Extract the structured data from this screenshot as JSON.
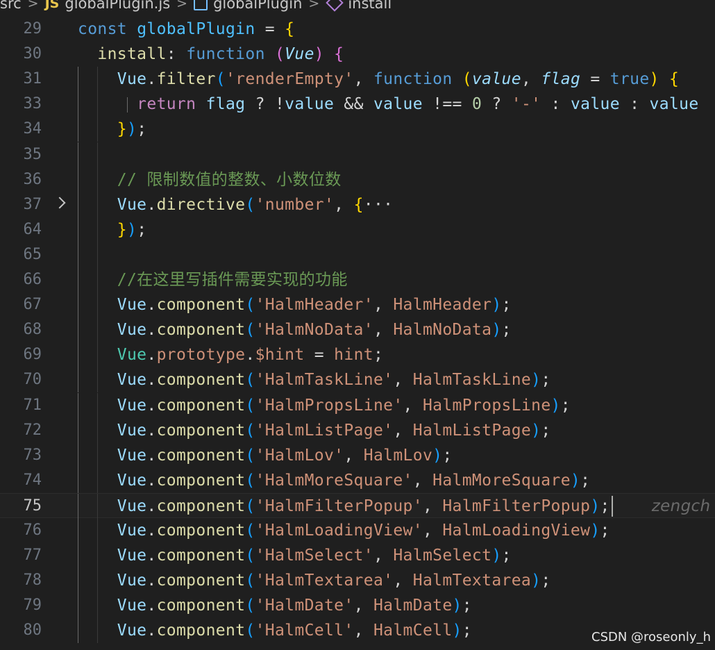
{
  "breadcrumb": {
    "folder": "src",
    "file_icon": "JS",
    "file": "globalPlugin.js",
    "symbol": "globalPlugin",
    "method": "install"
  },
  "editor": {
    "current_line": "75",
    "lines": [
      {
        "n": "29",
        "tokens": [
          [
            "c-kw",
            "const "
          ],
          [
            "c-def",
            "globalPlugin"
          ],
          [
            "c-pun",
            " = "
          ],
          [
            "c-br1",
            "{"
          ]
        ]
      },
      {
        "n": "30",
        "tokens": [
          [
            "c-fn",
            "  install"
          ],
          [
            "c-pun",
            ": "
          ],
          [
            "c-kw",
            "function "
          ],
          [
            "c-br2",
            "("
          ],
          [
            "c-prm",
            "Vue"
          ],
          [
            "c-br2",
            ")"
          ],
          [
            "c-pun",
            " "
          ],
          [
            "c-br2",
            "{"
          ]
        ]
      },
      {
        "n": "31",
        "tokens": [
          [
            "c-var",
            "    Vue"
          ],
          [
            "c-pun",
            "."
          ],
          [
            "c-fn",
            "filter"
          ],
          [
            "c-br3",
            "("
          ],
          [
            "c-str",
            "'renderEmpty'"
          ],
          [
            "c-pun",
            ", "
          ],
          [
            "c-kw",
            "function "
          ],
          [
            "c-br1",
            "("
          ],
          [
            "c-prm",
            "value"
          ],
          [
            "c-pun",
            ", "
          ],
          [
            "c-prm",
            "flag"
          ],
          [
            "c-pun",
            " = "
          ],
          [
            "c-kw",
            "true"
          ],
          [
            "c-br1",
            ")"
          ],
          [
            "c-pun",
            " "
          ],
          [
            "c-br1",
            "{"
          ]
        ]
      },
      {
        "n": "33",
        "tokens": [
          [
            "c-ctl",
            "      return "
          ],
          [
            "c-var",
            "flag"
          ],
          [
            "c-pun",
            " ? "
          ],
          [
            "c-pun",
            "!"
          ],
          [
            "c-var",
            "value"
          ],
          [
            "c-pun",
            " && "
          ],
          [
            "c-var",
            "value"
          ],
          [
            "c-pun",
            " !== "
          ],
          [
            "c-num",
            "0"
          ],
          [
            "c-pun",
            " ? "
          ],
          [
            "c-str",
            "'-'"
          ],
          [
            "c-pun",
            " : "
          ],
          [
            "c-var",
            "value"
          ],
          [
            "c-pun",
            " : "
          ],
          [
            "c-var",
            "value"
          ]
        ]
      },
      {
        "n": "34",
        "tokens": [
          [
            "c-br1",
            "    }"
          ],
          [
            "c-br3",
            ")"
          ],
          [
            "c-pun",
            ";"
          ]
        ]
      },
      {
        "n": "35",
        "tokens": []
      },
      {
        "n": "36",
        "tokens": [
          [
            "c-cm",
            "    // 限制数值的整数、小数位数"
          ]
        ]
      },
      {
        "n": "37",
        "fold": true,
        "tokens": [
          [
            "c-var",
            "    Vue"
          ],
          [
            "c-pun",
            "."
          ],
          [
            "c-fn",
            "directive"
          ],
          [
            "c-br3",
            "("
          ],
          [
            "c-str",
            "'number'"
          ],
          [
            "c-pun",
            ", "
          ],
          [
            "c-br1",
            "{"
          ],
          [
            "c-pun",
            "···"
          ]
        ]
      },
      {
        "n": "64",
        "tokens": [
          [
            "c-br1",
            "    }"
          ],
          [
            "c-br3",
            ")"
          ],
          [
            "c-pun",
            ";"
          ]
        ]
      },
      {
        "n": "65",
        "tokens": []
      },
      {
        "n": "66",
        "tokens": [
          [
            "c-cm",
            "    //在这里写插件需要实现的功能"
          ]
        ]
      },
      {
        "n": "67",
        "tokens": [
          [
            "c-var",
            "    Vue"
          ],
          [
            "c-pun",
            "."
          ],
          [
            "c-fn",
            "component"
          ],
          [
            "c-br3",
            "("
          ],
          [
            "c-str",
            "'HalmHeader'"
          ],
          [
            "c-pun",
            ", "
          ],
          [
            "c-str",
            "HalmHeader"
          ],
          [
            "c-br3",
            ")"
          ],
          [
            "c-pun",
            ";"
          ]
        ]
      },
      {
        "n": "68",
        "tokens": [
          [
            "c-var",
            "    Vue"
          ],
          [
            "c-pun",
            "."
          ],
          [
            "c-fn",
            "component"
          ],
          [
            "c-br3",
            "("
          ],
          [
            "c-str",
            "'HalmNoData'"
          ],
          [
            "c-pun",
            ", "
          ],
          [
            "c-str",
            "HalmNoData"
          ],
          [
            "c-br3",
            ")"
          ],
          [
            "c-pun",
            ";"
          ]
        ]
      },
      {
        "n": "69",
        "tokens": [
          [
            "c-cls",
            "    Vue"
          ],
          [
            "c-pun",
            "."
          ],
          [
            "c-str",
            "prototype"
          ],
          [
            "c-pun",
            "."
          ],
          [
            "c-str",
            "$hint"
          ],
          [
            "c-pun",
            " = "
          ],
          [
            "c-str",
            "hint"
          ],
          [
            "c-pun",
            ";"
          ]
        ]
      },
      {
        "n": "70",
        "tokens": [
          [
            "c-var",
            "    Vue"
          ],
          [
            "c-pun",
            "."
          ],
          [
            "c-fn",
            "component"
          ],
          [
            "c-br3",
            "("
          ],
          [
            "c-str",
            "'HalmTaskLine'"
          ],
          [
            "c-pun",
            ", "
          ],
          [
            "c-str",
            "HalmTaskLine"
          ],
          [
            "c-br3",
            ")"
          ],
          [
            "c-pun",
            ";"
          ]
        ]
      },
      {
        "n": "71",
        "tokens": [
          [
            "c-var",
            "    Vue"
          ],
          [
            "c-pun",
            "."
          ],
          [
            "c-fn",
            "component"
          ],
          [
            "c-br3",
            "("
          ],
          [
            "c-str",
            "'HalmPropsLine'"
          ],
          [
            "c-pun",
            ", "
          ],
          [
            "c-str",
            "HalmPropsLine"
          ],
          [
            "c-br3",
            ")"
          ],
          [
            "c-pun",
            ";"
          ]
        ]
      },
      {
        "n": "72",
        "tokens": [
          [
            "c-var",
            "    Vue"
          ],
          [
            "c-pun",
            "."
          ],
          [
            "c-fn",
            "component"
          ],
          [
            "c-br3",
            "("
          ],
          [
            "c-str",
            "'HalmListPage'"
          ],
          [
            "c-pun",
            ", "
          ],
          [
            "c-str",
            "HalmListPage"
          ],
          [
            "c-br3",
            ")"
          ],
          [
            "c-pun",
            ";"
          ]
        ]
      },
      {
        "n": "73",
        "tokens": [
          [
            "c-var",
            "    Vue"
          ],
          [
            "c-pun",
            "."
          ],
          [
            "c-fn",
            "component"
          ],
          [
            "c-br3",
            "("
          ],
          [
            "c-str",
            "'HalmLov'"
          ],
          [
            "c-pun",
            ", "
          ],
          [
            "c-str",
            "HalmLov"
          ],
          [
            "c-br3",
            ")"
          ],
          [
            "c-pun",
            ";"
          ]
        ]
      },
      {
        "n": "74",
        "tokens": [
          [
            "c-var",
            "    Vue"
          ],
          [
            "c-pun",
            "."
          ],
          [
            "c-fn",
            "component"
          ],
          [
            "c-br3",
            "("
          ],
          [
            "c-str",
            "'HalmMoreSquare'"
          ],
          [
            "c-pun",
            ", "
          ],
          [
            "c-str",
            "HalmMoreSquare"
          ],
          [
            "c-br3",
            ")"
          ],
          [
            "c-pun",
            ";"
          ]
        ]
      },
      {
        "n": "75",
        "cursor": true,
        "blame": "zengch",
        "tokens": [
          [
            "c-var",
            "    Vue"
          ],
          [
            "c-pun",
            "."
          ],
          [
            "c-fn",
            "component"
          ],
          [
            "c-br3",
            "("
          ],
          [
            "c-str",
            "'HalmFilterPopup'"
          ],
          [
            "c-pun",
            ", "
          ],
          [
            "c-str",
            "HalmFilterPopup"
          ],
          [
            "c-br3",
            ")"
          ],
          [
            "c-pun",
            ";"
          ]
        ]
      },
      {
        "n": "76",
        "tokens": [
          [
            "c-var",
            "    Vue"
          ],
          [
            "c-pun",
            "."
          ],
          [
            "c-fn",
            "component"
          ],
          [
            "c-br3",
            "("
          ],
          [
            "c-str",
            "'HalmLoadingView'"
          ],
          [
            "c-pun",
            ", "
          ],
          [
            "c-str",
            "HalmLoadingView"
          ],
          [
            "c-br3",
            ")"
          ],
          [
            "c-pun",
            ";"
          ]
        ]
      },
      {
        "n": "77",
        "tokens": [
          [
            "c-var",
            "    Vue"
          ],
          [
            "c-pun",
            "."
          ],
          [
            "c-fn",
            "component"
          ],
          [
            "c-br3",
            "("
          ],
          [
            "c-str",
            "'HalmSelect'"
          ],
          [
            "c-pun",
            ", "
          ],
          [
            "c-str",
            "HalmSelect"
          ],
          [
            "c-br3",
            ")"
          ],
          [
            "c-pun",
            ";"
          ]
        ]
      },
      {
        "n": "78",
        "tokens": [
          [
            "c-var",
            "    Vue"
          ],
          [
            "c-pun",
            "."
          ],
          [
            "c-fn",
            "component"
          ],
          [
            "c-br3",
            "("
          ],
          [
            "c-str",
            "'HalmTextarea'"
          ],
          [
            "c-pun",
            ", "
          ],
          [
            "c-str",
            "HalmTextarea"
          ],
          [
            "c-br3",
            ")"
          ],
          [
            "c-pun",
            ";"
          ]
        ]
      },
      {
        "n": "79",
        "tokens": [
          [
            "c-var",
            "    Vue"
          ],
          [
            "c-pun",
            "."
          ],
          [
            "c-fn",
            "component"
          ],
          [
            "c-br3",
            "("
          ],
          [
            "c-str",
            "'HalmDate'"
          ],
          [
            "c-pun",
            ", "
          ],
          [
            "c-str",
            "HalmDate"
          ],
          [
            "c-br3",
            ")"
          ],
          [
            "c-pun",
            ";"
          ]
        ]
      },
      {
        "n": "80",
        "tokens": [
          [
            "c-var",
            "    Vue"
          ],
          [
            "c-pun",
            "."
          ],
          [
            "c-fn",
            "component"
          ],
          [
            "c-br3",
            "("
          ],
          [
            "c-str",
            "'HalmCell'"
          ],
          [
            "c-pun",
            ", "
          ],
          [
            "c-str",
            "HalmCell"
          ],
          [
            "c-br3",
            ")"
          ],
          [
            "c-pun",
            ";"
          ]
        ]
      }
    ]
  },
  "watermark": "CSDN @roseonly_h"
}
